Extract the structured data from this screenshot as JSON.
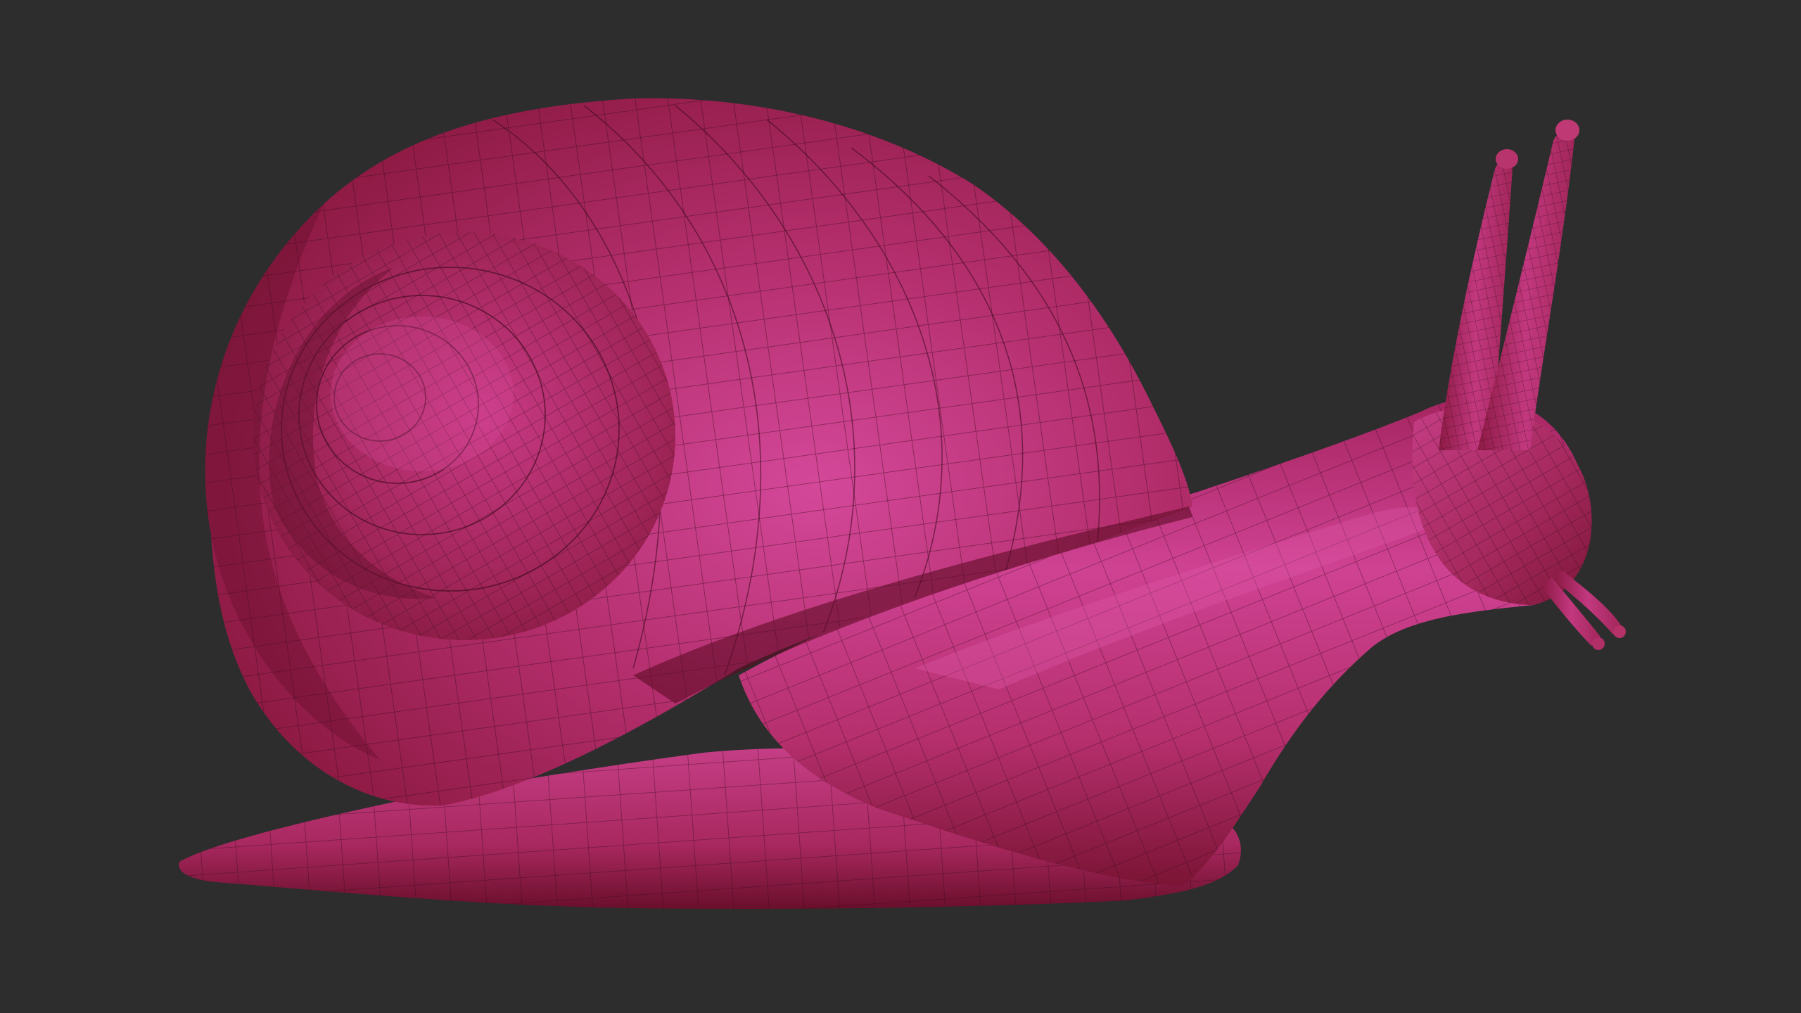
{
  "viewport": {
    "background_color": "#2d2d2d"
  },
  "model": {
    "subject": "snail",
    "material_colors": {
      "base": "#b3245f",
      "highlight": "#d8479b",
      "shadow": "#7e1434",
      "wire": "#3a0a1c"
    }
  }
}
